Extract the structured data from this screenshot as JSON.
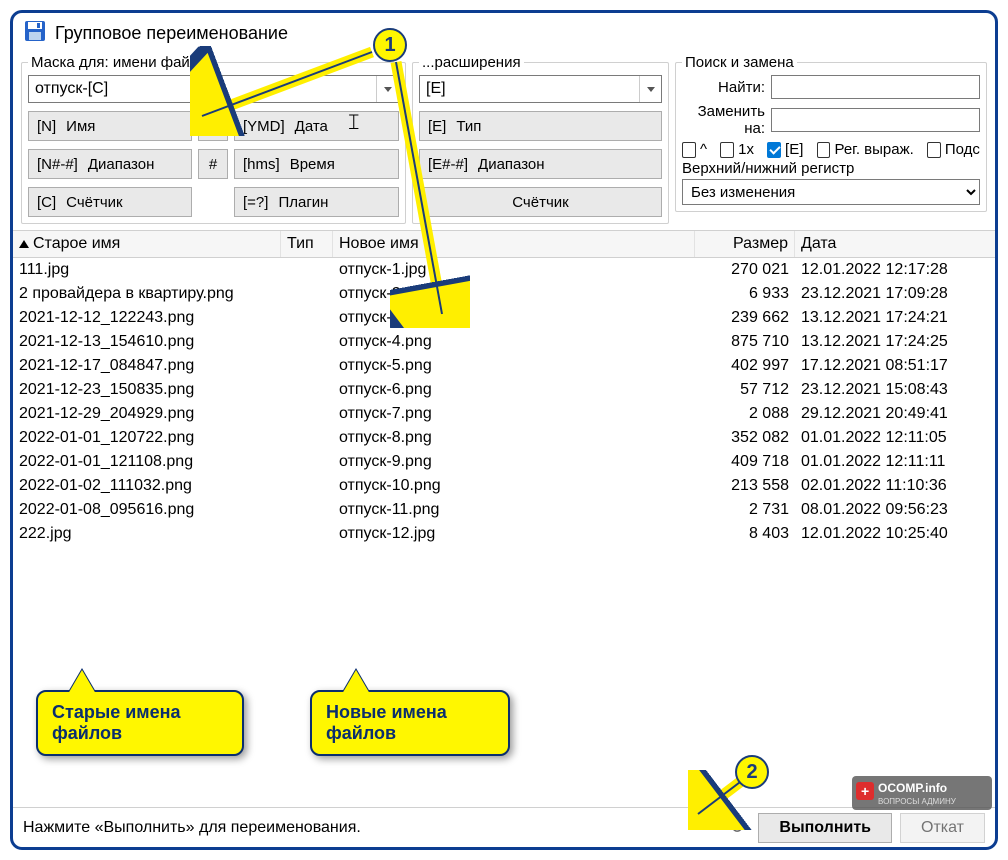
{
  "window": {
    "title": "Групповое переименование"
  },
  "mask": {
    "name_legend": "Маска для: имени файла",
    "ext_legend": "...расширения",
    "name_value": "отпуск-[C]",
    "ext_value": "[E]",
    "buttons": {
      "n": "[N]",
      "n_lbl": "Имя",
      "ymd": "[YMD]",
      "ymd_lbl": "Дата",
      "range": "[N#-#]",
      "range_lbl": "Диапазон",
      "hms": "[hms]",
      "hms_lbl": "Время",
      "c": "[C]",
      "c_lbl": "Счётчик",
      "plugin": "[=?]",
      "plugin_lbl": "Плагин",
      "plus": "±",
      "hash": "#",
      "e": "[E]",
      "e_lbl": "Тип",
      "erange": "[E#-#]",
      "erange_lbl": "Диапазон",
      "ec": "",
      "ec_lbl": "Счётчик"
    }
  },
  "search": {
    "legend": "Поиск и замена",
    "find_lbl": "Найти:",
    "replace_lbl": "Заменить на:",
    "find_val": "",
    "replace_val": "",
    "chk_caret": "^",
    "chk_once": "1x",
    "chk_e": "[E]",
    "chk_regex": "Рег. выраж.",
    "chk_sub": "Подс",
    "case_lbl": "Верхний/нижний регистр",
    "case_val": "Без изменения"
  },
  "columns": {
    "old": "Старое имя",
    "type": "Тип",
    "new": "Новое имя",
    "size": "Размер",
    "date": "Дата"
  },
  "rows": [
    {
      "old": "111.jpg",
      "new": "отпуск-1.jpg",
      "size": "270 021",
      "date": "12.01.2022 12:17:28"
    },
    {
      "old": "2 провайдера в квартиру.png",
      "new": "отпуск-2.png",
      "size": "6 933",
      "date": "23.12.2021 17:09:28"
    },
    {
      "old": "2021-12-12_122243.png",
      "new": "отпуск-3.png",
      "size": "239 662",
      "date": "13.12.2021 17:24:21"
    },
    {
      "old": "2021-12-13_154610.png",
      "new": "отпуск-4.png",
      "size": "875 710",
      "date": "13.12.2021 17:24:25"
    },
    {
      "old": "2021-12-17_084847.png",
      "new": "отпуск-5.png",
      "size": "402 997",
      "date": "17.12.2021 08:51:17"
    },
    {
      "old": "2021-12-23_150835.png",
      "new": "отпуск-6.png",
      "size": "57 712",
      "date": "23.12.2021 15:08:43"
    },
    {
      "old": "2021-12-29_204929.png",
      "new": "отпуск-7.png",
      "size": "2 088",
      "date": "29.12.2021 20:49:41"
    },
    {
      "old": "2022-01-01_120722.png",
      "new": "отпуск-8.png",
      "size": "352 082",
      "date": "01.01.2022 12:11:05"
    },
    {
      "old": "2022-01-01_121108.png",
      "new": "отпуск-9.png",
      "size": "409 718",
      "date": "01.01.2022 12:11:11"
    },
    {
      "old": "2022-01-02_111032.png",
      "new": "отпуск-10.png",
      "size": "213 558",
      "date": "02.01.2022 11:10:36"
    },
    {
      "old": "2022-01-08_095616.png",
      "new": "отпуск-11.png",
      "size": "2 731",
      "date": "08.01.2022 09:56:23"
    },
    {
      "old": "222.jpg",
      "new": "отпуск-12.jpg",
      "size": "8 403",
      "date": "12.01.2022 10:25:40"
    }
  ],
  "status": {
    "hint": "Нажмите «Выполнить» для переименования.",
    "execute": "Выполнить",
    "rollback": "Откат"
  },
  "annotations": {
    "badge1": "1",
    "badge2": "2",
    "callout_old": "Старые имена файлов",
    "callout_new": "Новые имена файлов",
    "watermark_top": "OCOMP.info",
    "watermark_bottom": "ВОПРОСЫ АДМИНУ"
  }
}
